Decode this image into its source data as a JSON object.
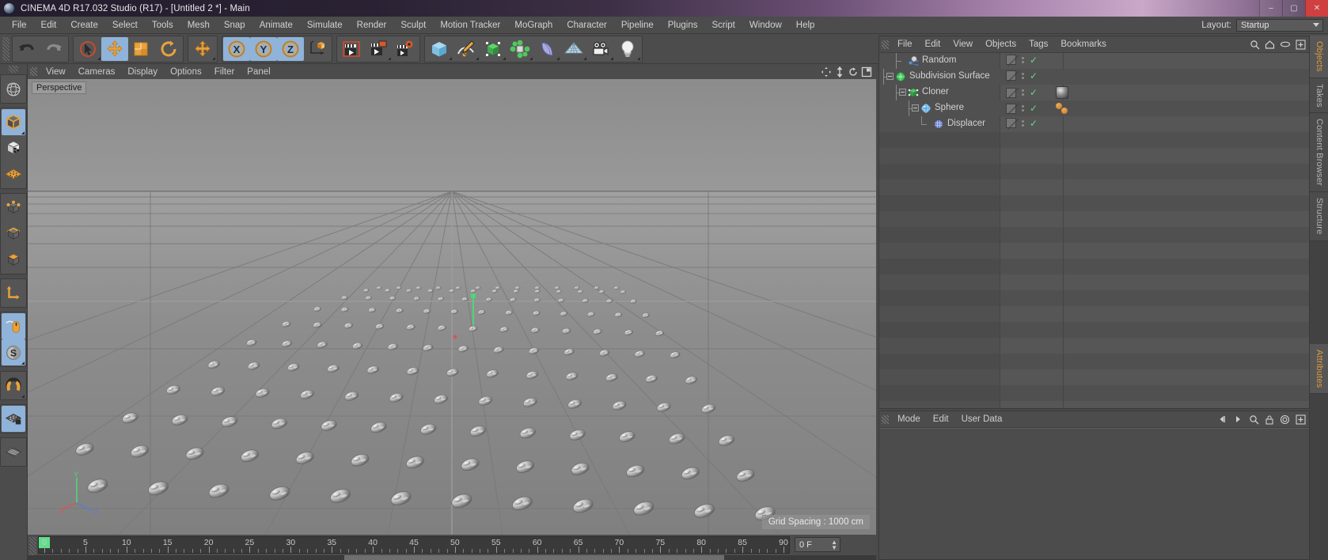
{
  "window": {
    "title": "CINEMA 4D R17.032 Studio (R17) - [Untitled 2 *] - Main",
    "app_icon": "c4d-logo-icon",
    "minimize": "–",
    "maximize": "▢",
    "close": "✕"
  },
  "menubar": {
    "items": [
      "File",
      "Edit",
      "Create",
      "Select",
      "Tools",
      "Mesh",
      "Snap",
      "Animate",
      "Simulate",
      "Render",
      "Sculpt",
      "Motion Tracker",
      "MoGraph",
      "Character",
      "Pipeline",
      "Plugins",
      "Script",
      "Window",
      "Help"
    ],
    "layout_label": "Layout:",
    "layout_value": "Startup"
  },
  "toolbar": {
    "groups": [
      {
        "buttons": [
          {
            "name": "undo-icon",
            "label": "Undo",
            "active": false
          },
          {
            "name": "redo-icon",
            "label": "Redo",
            "active": false
          }
        ]
      },
      {
        "buttons": [
          {
            "name": "live-selection-icon",
            "label": "Live Selection",
            "active": false,
            "corner": true
          },
          {
            "name": "move-tool-icon",
            "label": "Move",
            "active": true
          },
          {
            "name": "scale-tool-icon",
            "label": "Scale",
            "active": false
          },
          {
            "name": "rotate-tool-icon",
            "label": "Rotate",
            "active": false
          }
        ]
      },
      {
        "buttons": [
          {
            "name": "move-axis-icon",
            "label": "Move Axis",
            "active": false,
            "corner": true
          }
        ]
      },
      {
        "buttons": [
          {
            "name": "axis-x-lock-icon",
            "label": "X Axis",
            "active": true
          },
          {
            "name": "axis-y-lock-icon",
            "label": "Y Axis",
            "active": true
          },
          {
            "name": "axis-z-lock-icon",
            "label": "Z Axis",
            "active": true
          },
          {
            "name": "world-object-coordinate-icon",
            "label": "World/Object Coordinate System",
            "active": false
          }
        ]
      },
      {
        "buttons": [
          {
            "name": "render-view-icon",
            "label": "Render View",
            "active": false
          },
          {
            "name": "render-region-icon",
            "label": "Render Region",
            "active": false,
            "corner": true
          },
          {
            "name": "render-settings-icon",
            "label": "Render Settings",
            "active": false
          }
        ]
      },
      {
        "buttons": [
          {
            "name": "cube-primitive-icon",
            "label": "Add Cube Object",
            "active": false,
            "corner": true
          },
          {
            "name": "spline-pen-icon",
            "label": "Add Spline",
            "active": false,
            "corner": true
          },
          {
            "name": "generator-icon",
            "label": "Add Generator",
            "active": false,
            "corner": true
          },
          {
            "name": "mograph-icon",
            "label": "MoGraph",
            "active": false,
            "corner": true
          },
          {
            "name": "deformer-icon",
            "label": "Add Deformer",
            "active": false,
            "corner": true
          },
          {
            "name": "scene-floor-icon",
            "label": "Add Scene Object",
            "active": false,
            "corner": true
          },
          {
            "name": "camera-icon",
            "label": "Add Camera",
            "active": false,
            "corner": true
          },
          {
            "name": "light-icon",
            "label": "Add Light",
            "active": false,
            "corner": true
          }
        ]
      }
    ]
  },
  "left_toolbar": {
    "groups": [
      {
        "buttons": [
          {
            "name": "axis-globe-icon",
            "label": "Make Editable / Axis",
            "active": false
          }
        ]
      },
      {
        "buttons": [
          {
            "name": "object-mode-icon",
            "label": "Model Mode",
            "active": true,
            "corner": true
          },
          {
            "name": "texture-mode-icon",
            "label": "Texture Mode",
            "active": false
          },
          {
            "name": "workplane-icon",
            "label": "Workplane",
            "active": false
          }
        ]
      },
      {
        "buttons": [
          {
            "name": "points-mode-icon",
            "label": "Points Mode",
            "active": false
          },
          {
            "name": "edges-mode-icon",
            "label": "Edges Mode",
            "active": false
          },
          {
            "name": "polygons-mode-icon",
            "label": "Polygons Mode",
            "active": false
          }
        ]
      },
      {
        "buttons": [
          {
            "name": "object-axis-icon",
            "label": "Enable Axis Modification",
            "active": false
          }
        ]
      },
      {
        "buttons": [
          {
            "name": "viewport-solo-mouse-icon",
            "label": "Viewport Solo",
            "active": true
          },
          {
            "name": "snap-enable-icon",
            "label": "Enable Snap",
            "active": true,
            "corner": true
          }
        ]
      },
      {
        "buttons": [
          {
            "name": "magnet-icon",
            "label": "Magnet",
            "active": false,
            "corner": true
          }
        ]
      },
      {
        "buttons": [
          {
            "name": "workplane-lock-icon",
            "label": "Lock Workplane",
            "active": true
          }
        ]
      },
      {
        "buttons": [
          {
            "name": "workplane-grid-icon",
            "label": "Planar Workplane",
            "active": false
          }
        ]
      }
    ]
  },
  "viewport": {
    "menus": [
      "View",
      "Cameras",
      "Display",
      "Options",
      "Filter",
      "Panel"
    ],
    "nav_icons": [
      "pan-icon",
      "zoom-icon",
      "rotate-view-icon",
      "maximize-view-icon"
    ],
    "projection_label": "Perspective",
    "grid_spacing_label": "Grid Spacing : 1000 cm",
    "axis_gizmo": {
      "x": "X",
      "y": "Y",
      "z": "Z"
    }
  },
  "timeline": {
    "tick_labels": [
      "0",
      "5",
      "10",
      "15",
      "20",
      "25",
      "30",
      "35",
      "40",
      "45",
      "50",
      "55",
      "60",
      "65",
      "70",
      "75",
      "80",
      "85",
      "90"
    ],
    "tick_values": [
      0,
      5,
      10,
      15,
      20,
      25,
      30,
      35,
      40,
      45,
      50,
      55,
      60,
      65,
      70,
      75,
      80,
      85,
      90
    ],
    "current_frame": "0 F",
    "playhead_frame": 0,
    "range_start": 0,
    "range_end": 90
  },
  "object_manager": {
    "menus": [
      "File",
      "Edit",
      "View",
      "Objects",
      "Tags",
      "Bookmarks"
    ],
    "header_icons": [
      "search-icon",
      "home-icon",
      "eye-icon",
      "plus-icon"
    ],
    "objects": [
      {
        "name": "Random",
        "icon": "random-effector-icon",
        "depth": 1,
        "expandable": false,
        "tags": [
          "slash",
          "dots",
          "check"
        ]
      },
      {
        "name": "Subdivision Surface",
        "icon": "subdivision-surface-icon",
        "depth": 0,
        "expandable": true,
        "tags": [
          "slash",
          "dots",
          "check"
        ]
      },
      {
        "name": "Cloner",
        "icon": "cloner-icon",
        "depth": 1,
        "expandable": true,
        "tags": [
          "slash",
          "dots",
          "check",
          "material"
        ]
      },
      {
        "name": "Sphere",
        "icon": "sphere-icon",
        "depth": 2,
        "expandable": true,
        "tags": [
          "slash",
          "dots",
          "check",
          "mograph"
        ]
      },
      {
        "name": "Displacer",
        "icon": "displacer-icon",
        "depth": 3,
        "expandable": false,
        "tags": [
          "slash",
          "dots",
          "check"
        ]
      }
    ]
  },
  "attribute_manager": {
    "menus": [
      "Mode",
      "Edit",
      "User Data"
    ],
    "header_icons": [
      "prev-icon",
      "next-icon",
      "lock-icon",
      "target-icon",
      "plus-icon"
    ]
  },
  "right_tabs": {
    "top": [
      {
        "label": "Objects",
        "active": true
      },
      {
        "label": "Takes",
        "active": false
      },
      {
        "label": "Content Browser",
        "active": false
      },
      {
        "label": "Structure",
        "active": false
      }
    ],
    "bottom": [
      {
        "label": "Attributes",
        "active": true
      }
    ]
  },
  "colors": {
    "accent_orange": "#e09a3c",
    "active_blue": "#8fb3d9",
    "panel_bg": "#4c4c4c",
    "check_green": "#5fd98e",
    "playhead_green": "#5fe08a"
  }
}
